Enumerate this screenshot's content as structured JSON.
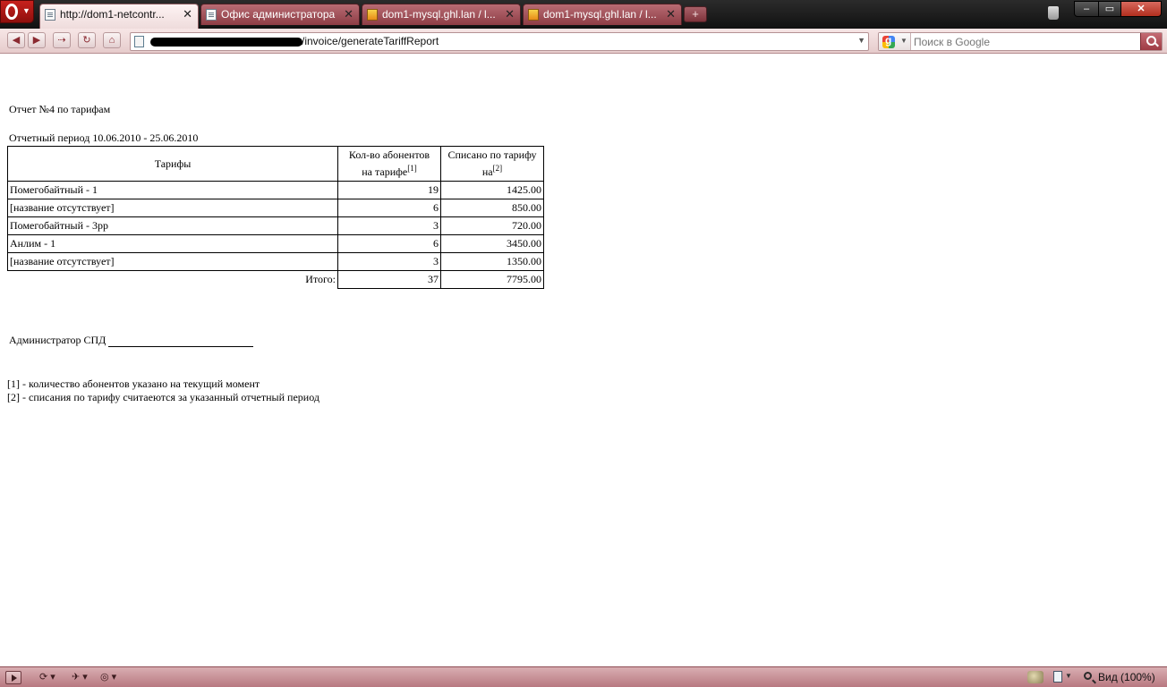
{
  "browser": {
    "tabs": [
      {
        "label": "http://dom1-netcontr...",
        "active": true,
        "icon": "page-icon"
      },
      {
        "label": "Офис администратора",
        "active": false,
        "icon": "page-icon"
      },
      {
        "label": "dom1-mysql.ghl.lan / l...",
        "active": false,
        "icon": "phpmyadmin-icon"
      },
      {
        "label": "dom1-mysql.ghl.lan / l...",
        "active": false,
        "icon": "phpmyadmin-icon"
      }
    ],
    "tab_close_glyph": "✕",
    "new_tab_glyph": "+",
    "address": {
      "path": "/invoice/generateTariffReport"
    },
    "search": {
      "placeholder": "Поиск в Google",
      "engine_icon": "google-icon"
    },
    "accent_color": "#b86b73"
  },
  "report": {
    "title": "Отчет №4 по тарифам",
    "period": "Отчетный период 10.06.2010 - 25.06.2010",
    "columns": {
      "tariff": "Тарифы",
      "subscribers_line1": "Кол-во абонентов",
      "subscribers_line2": "на тарифе",
      "subscribers_note": "[1]",
      "charged_line1": "Списано по тарифу",
      "charged_line2": "на",
      "charged_note": "[2]"
    },
    "rows": [
      {
        "name": "Помегобайтный - 1",
        "count": "19",
        "amount": "1425.00"
      },
      {
        "name": "[название отсутствует]",
        "count": "6",
        "amount": "850.00"
      },
      {
        "name": "Помегобайтный - 3рр",
        "count": "3",
        "amount": "720.00"
      },
      {
        "name": "Анлим - 1",
        "count": "6",
        "amount": "3450.00"
      },
      {
        "name": "[название отсутствует]",
        "count": "3",
        "amount": "1350.00"
      }
    ],
    "total": {
      "label": "Итого:",
      "count": "37",
      "amount": "7795.00"
    },
    "signature": "Администратор СПД",
    "footnotes": [
      "[1] - количество абонентов указано на текущий момент",
      "[2] - списания по тарифу считаеются за указанный отчетный период"
    ]
  },
  "statusbar": {
    "view_label": "Вид (100%)"
  }
}
